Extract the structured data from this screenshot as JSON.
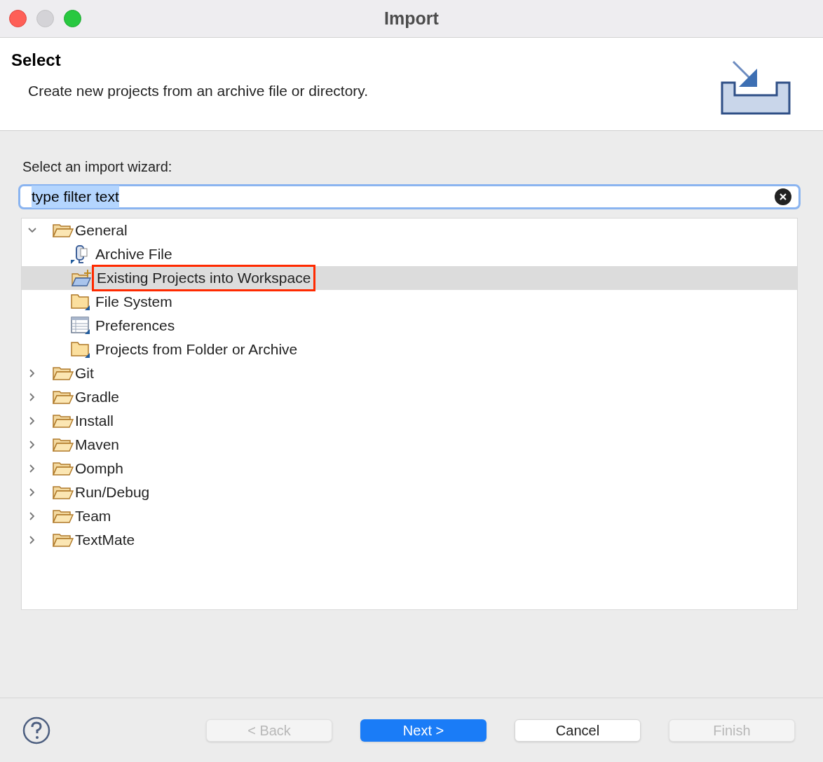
{
  "window": {
    "title": "Import"
  },
  "header": {
    "title": "Select",
    "description": "Create new projects from an archive file or directory."
  },
  "filter": {
    "label": "Select an import wizard:",
    "value": "type filter text",
    "text_selected": true
  },
  "tree": [
    {
      "label": "General",
      "expanded": true,
      "selected": false,
      "children": [
        {
          "label": "Archive File",
          "kind": "archive",
          "selected": false,
          "outlined": false
        },
        {
          "label": "Existing Projects into Workspace",
          "kind": "project",
          "selected": true,
          "outlined": true
        },
        {
          "label": "File System",
          "kind": "folder",
          "selected": false,
          "outlined": false
        },
        {
          "label": "Preferences",
          "kind": "preferences",
          "selected": false,
          "outlined": false
        },
        {
          "label": "Projects from Folder or Archive",
          "kind": "folder",
          "selected": false,
          "outlined": false
        }
      ]
    },
    {
      "label": "Git",
      "expanded": false,
      "selected": false
    },
    {
      "label": "Gradle",
      "expanded": false,
      "selected": false
    },
    {
      "label": "Install",
      "expanded": false,
      "selected": false
    },
    {
      "label": "Maven",
      "expanded": false,
      "selected": false
    },
    {
      "label": "Oomph",
      "expanded": false,
      "selected": false
    },
    {
      "label": "Run/Debug",
      "expanded": false,
      "selected": false
    },
    {
      "label": "Team",
      "expanded": false,
      "selected": false
    },
    {
      "label": "TextMate",
      "expanded": false,
      "selected": false
    }
  ],
  "buttons": [
    {
      "label": "< Back",
      "kind": "normal",
      "disabled": true
    },
    {
      "label": "Next >",
      "kind": "primary",
      "disabled": false
    },
    {
      "label": "Cancel",
      "kind": "normal",
      "disabled": false
    },
    {
      "label": "Finish",
      "kind": "normal",
      "disabled": true
    }
  ]
}
